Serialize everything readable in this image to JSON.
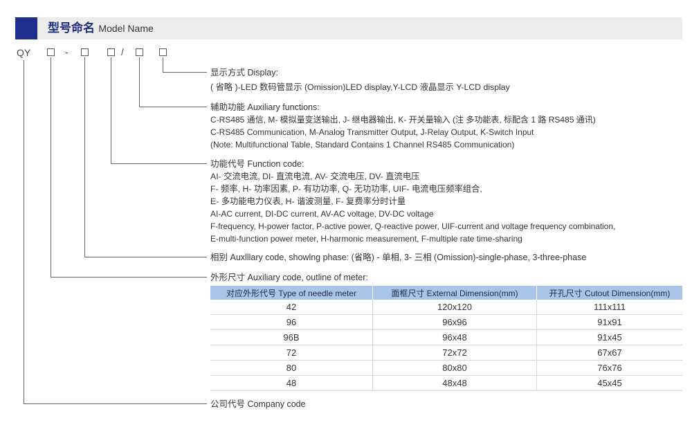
{
  "header": {
    "title_cn": "型号命名",
    "title_en": "Model Name",
    "accent_color": "#1f2f8e"
  },
  "code": {
    "prefix": "QY",
    "dash": "-",
    "slash": "/"
  },
  "sections": {
    "display": {
      "label_cn": "显示方式",
      "label_en": "Display:",
      "line1": "( 省略 )-LED 数码管显示 (Omission)LED display,Y-LCD 液晶显示 Y-LCD display"
    },
    "auxiliary": {
      "label_cn": "辅助功能",
      "label_en": "Auxiliary functions:",
      "line1": "C-RS485 通信, M- 模拟量变送输出, J- 继电器输出, K- 开关量输入 (注  多功能表, 标配含 1 路 RS485 通讯)",
      "line2": "C-RS485 Communication, M-Analog Transmitter Output, J-Relay Output, K-Switch Input",
      "line3": "(Note: Multifunctional Table, Standard Contains 1 Channel RS485 Communication)"
    },
    "function": {
      "label_cn": "功能代号",
      "label_en": "Function code:",
      "line1": "AI- 交流电流, DI- 直流电流, AV- 交流电压, DV- 直流电压",
      "line2": "F- 频率, H- 功率因素, P- 有功功率, Q- 无功功率, UIF- 电流电压频率组合,",
      "line3": "E- 多功能电力仪表, H- 谐波测量, F- 复费率分时计量",
      "line4": "AI-AC current, DI-DC current, AV-AC voltage, DV-DC voltage",
      "line5": "F-frequency, H-power factor, P-active power, Q-reactive power, UIF-current and voltage frequency combination,",
      "line6": "E-multi-function power meter, H-harmonic measurement, F-multiple rate time-sharing"
    },
    "phase": {
      "label_cn": "相别",
      "text": "Auxlllary code, showlng phase: (省略) - 单相, 3- 三相 (Omission)-single-phase, 3-three-phase"
    },
    "outline": {
      "label_cn": "外形尺寸",
      "label_en": "Auxiliary code, outline of meter:",
      "table_headers": [
        "对应外形代号 Type of needle meter",
        "面框尺寸 External Dimension(mm)",
        "开孔尺寸 Cutout Dimension(mm)"
      ],
      "table_rows": [
        [
          "42",
          "120x120",
          "111x111"
        ],
        [
          "96",
          "96x96",
          "91x91"
        ],
        [
          "96B",
          "96x48",
          "91x45"
        ],
        [
          "72",
          "72x72",
          "67x67"
        ],
        [
          "80",
          "80x80",
          "76x76"
        ],
        [
          "48",
          "48x48",
          "45x45"
        ]
      ]
    },
    "company": {
      "label_cn": "公司代号",
      "label_en": "Company code"
    }
  }
}
